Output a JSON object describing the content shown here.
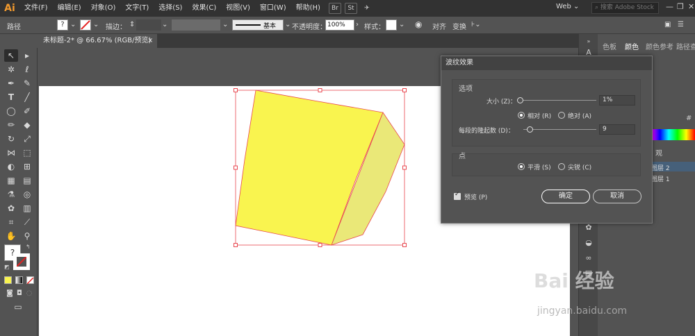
{
  "app": {
    "logo": "Ai",
    "brand_color": "#f29a2e"
  },
  "menubar": {
    "items": [
      "文件(F)",
      "编辑(E)",
      "对象(O)",
      "文字(T)",
      "选择(S)",
      "效果(C)",
      "视图(V)",
      "窗口(W)",
      "帮助(H)"
    ],
    "chips": [
      "Br",
      "St"
    ],
    "workspace": "Web",
    "stock_search_placeholder": "搜索 Adobe Stock"
  },
  "control_bar": {
    "selection_label": "路径",
    "stroke_label": "描边：",
    "stroke_style": "基本",
    "opacity_label": "不透明度：",
    "opacity_value": "100%",
    "style_label": "样式：",
    "align_label": "对齐",
    "transform_label": "变换"
  },
  "document_tab": {
    "title": "未标题-2* @ 66.67% (RGB/预览)",
    "close": "×"
  },
  "right_panel": {
    "tabs": [
      "色板",
      "颜色",
      "颜色参考",
      "路径查找器"
    ],
    "hex_label": "#",
    "appearance_tab": "观",
    "layers": [
      "图层 2",
      "图层 1"
    ]
  },
  "dialog": {
    "title": "波纹效果",
    "options_group": "选项",
    "size_label": "大小 (Z)：",
    "size_value": "1%",
    "relative_label": "相对 (R)",
    "absolute_label": "绝对 (A)",
    "size_mode": "relative",
    "ridges_label": "每段的隆起数 (D)：",
    "ridges_value": "9",
    "size_slider_fraction": 0.0,
    "ridges_slider_fraction": 0.09,
    "points_group": "点",
    "smooth_label": "平滑 (S)",
    "corner_label": "尖锐 (C)",
    "points_mode": "smooth",
    "preview_label": "预览 (P)",
    "preview_checked": true,
    "ok_label": "确定",
    "cancel_label": "取消"
  },
  "artwork": {
    "front_fill": "#f9f44f",
    "side_fill": "#eae878",
    "selection_color": "#e8474f"
  },
  "watermark": {
    "text": "Bai 经验",
    "url": "jingyan.baidu.com"
  }
}
